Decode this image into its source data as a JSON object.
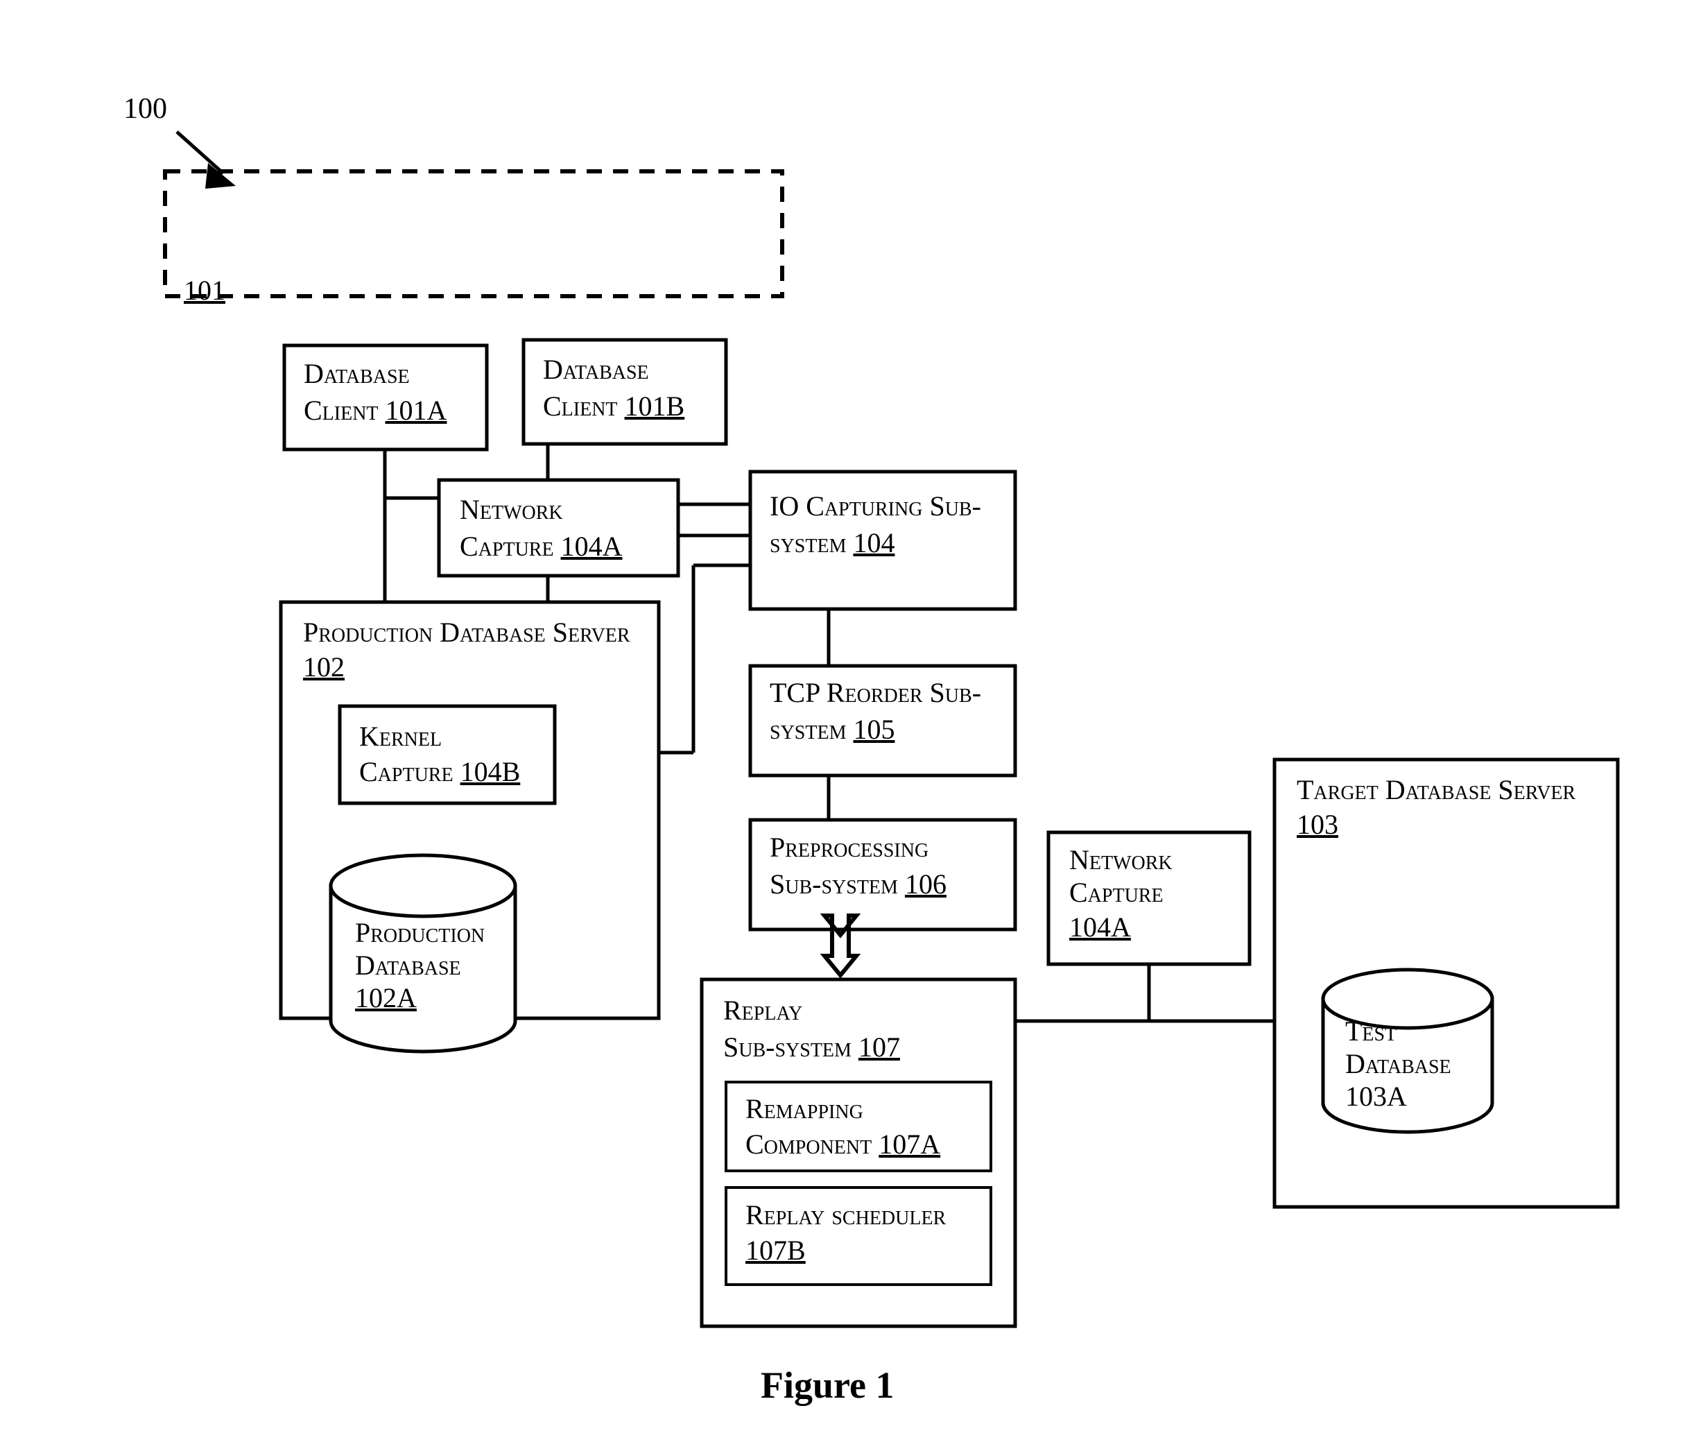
{
  "figure": {
    "caption": "Figure 1",
    "system_label": "100",
    "group_label": "101"
  },
  "nodes": {
    "db_client_a": {
      "line1": "Database",
      "line2": "Client ",
      "ref": "101A"
    },
    "db_client_b": {
      "line1": "Database",
      "line2": "Client ",
      "ref": "101B"
    },
    "network_capture_a": {
      "line1": "Network",
      "line2": "Capture ",
      "ref": "104A"
    },
    "io_capturing": {
      "line1": "IO Capturing Sub-",
      "line2": "system ",
      "ref": "104"
    },
    "production_server": {
      "line1": "Production Database Server",
      "line2": "",
      "ref": "102"
    },
    "kernel_capture": {
      "line1": "Kernel",
      "line2": "Capture ",
      "ref": "104B"
    },
    "tcp_reorder": {
      "line1": "TCP Reorder Sub-",
      "line2": "system ",
      "ref": "105"
    },
    "preprocessing": {
      "line1": "Preprocessing",
      "line2": "Sub-system ",
      "ref": "106"
    },
    "production_db": {
      "line1": "Production",
      "line2": "Database",
      "ref": "102A"
    },
    "network_capture_b": {
      "line1": "Network",
      "line2": "Capture",
      "ref": "104A"
    },
    "target_server": {
      "line1": "Target Database Server",
      "line2": "",
      "ref": "103"
    },
    "replay_subsystem": {
      "line1": "Replay",
      "line2": "Sub-system ",
      "ref": "107"
    },
    "remapping": {
      "line1": "Remapping",
      "line2": "Component ",
      "ref": "107A"
    },
    "replay_scheduler": {
      "line1": "Replay scheduler",
      "line2": "",
      "ref": "107B"
    },
    "test_db": {
      "line1": "Test",
      "line2": "Database",
      "ref": "103A"
    }
  },
  "colors": {
    "stroke": "#000000",
    "fill": "#ffffff"
  }
}
